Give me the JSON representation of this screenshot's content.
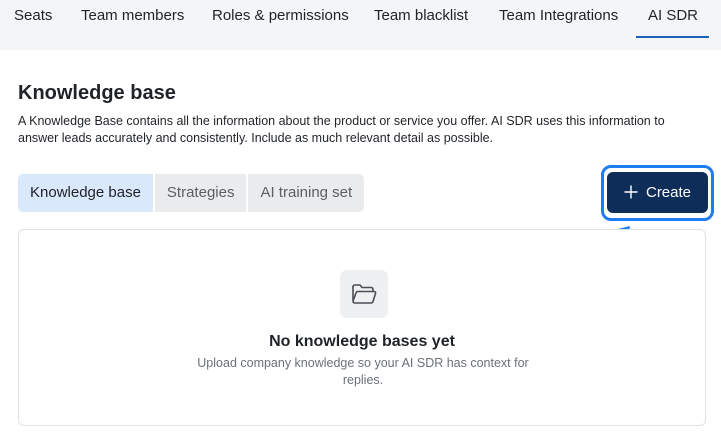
{
  "top_tabs": [
    {
      "label": "Seats",
      "active": false
    },
    {
      "label": "Team members",
      "active": false
    },
    {
      "label": "Roles & permissions",
      "active": false
    },
    {
      "label": "Team blacklist",
      "active": false
    },
    {
      "label": "Team Integrations",
      "active": false
    },
    {
      "label": "AI SDR",
      "active": true
    }
  ],
  "page": {
    "title": "Knowledge base",
    "description": "A Knowledge Base contains all the information about the product or service you offer. AI SDR uses this information to answer leads accurately and consistently. Include as much relevant detail as possible."
  },
  "sub_tabs": [
    {
      "label": "Knowledge base",
      "active": true
    },
    {
      "label": "Strategies",
      "active": false
    },
    {
      "label": "AI training set",
      "active": false
    }
  ],
  "create_button": {
    "label": "Create",
    "icon": "plus-icon"
  },
  "empty_state": {
    "icon": "folder-open-icon",
    "title": "No knowledge bases yet",
    "description": "Upload company knowledge so your AI SDR has context for replies."
  },
  "colors": {
    "accent": "#1d62b8",
    "button_bg": "#0f2d59",
    "highlight": "#1d7cf2",
    "active_subtab_bg": "#d9e8fb"
  }
}
